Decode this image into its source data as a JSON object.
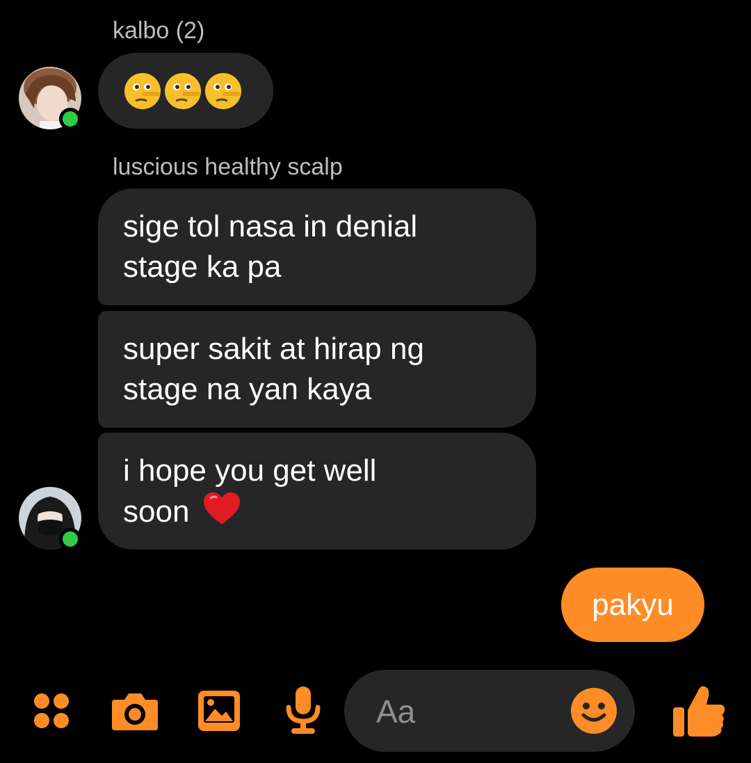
{
  "colors": {
    "accent": "#ff8c26",
    "background": "#000000",
    "incoming_bubble": "#262626",
    "secondary_text": "#bdbdbd",
    "online": "#31cc46"
  },
  "messages": [
    {
      "sender": "kalbo (2)",
      "text": "",
      "emoji": [
        "lying-face",
        "lying-face",
        "lying-face"
      ]
    },
    {
      "sender": "luscious healthy scalp",
      "texts": [
        "sige tol nasa in denial\nstage ka pa",
        "super sakit at hirap ng\nstage na yan kaya",
        "i hope you get well\nsoon"
      ],
      "trailing_emoji": "heart"
    }
  ],
  "own_message": "pakyu",
  "composer": {
    "placeholder": "Aa"
  },
  "toolbar": {
    "icons": [
      "menu-dots-icon",
      "camera-icon",
      "image-icon",
      "microphone-icon",
      "emoji-icon",
      "thumbs-up-icon"
    ]
  }
}
